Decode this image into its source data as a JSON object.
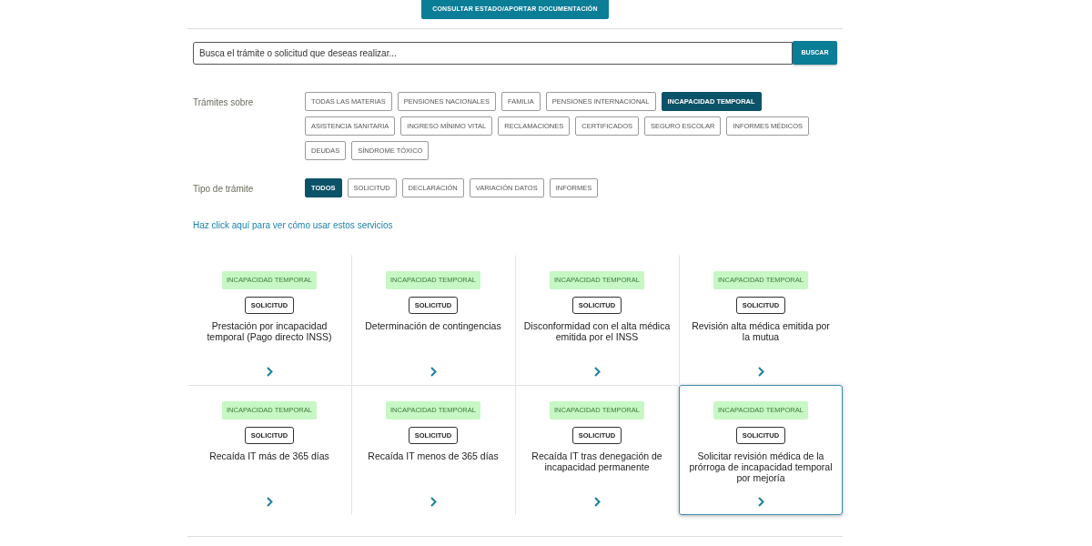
{
  "header": {
    "status_button": "CONSULTAR ESTADO/APORTAR DOCUMENTACIÓN"
  },
  "search": {
    "placeholder": "Busca el trámite o solicitud que deseas realizar...",
    "button": "BUSCAR"
  },
  "filters": [
    {
      "label": "Trámites sobre",
      "options": [
        {
          "label": "TODAS LAS MATERIAS",
          "selected": false
        },
        {
          "label": "PENSIONES NACIONALES",
          "selected": false
        },
        {
          "label": "FAMILIA",
          "selected": false
        },
        {
          "label": "PENSIONES INTERNACIONAL",
          "selected": false
        },
        {
          "label": "INCAPACIDAD TEMPORAL",
          "selected": true
        },
        {
          "label": "ASISTENCIA SANITARIA",
          "selected": false
        },
        {
          "label": "INGRESO MÍNIMO VITAL",
          "selected": false
        },
        {
          "label": "RECLAMACIONES",
          "selected": false
        },
        {
          "label": "CERTIFICADOS",
          "selected": false
        },
        {
          "label": "SEGURO ESCOLAR",
          "selected": false
        },
        {
          "label": "INFORMES MÉDICOS",
          "selected": false
        },
        {
          "label": "DEUDAS",
          "selected": false
        },
        {
          "label": "SÍNDROME TÓXICO",
          "selected": false
        }
      ]
    },
    {
      "label": "Tipo de trámite",
      "options": [
        {
          "label": "TODOS",
          "selected": true
        },
        {
          "label": "SOLICITUD",
          "selected": false
        },
        {
          "label": "DECLARACIÓN",
          "selected": false
        },
        {
          "label": "VARIACIÓN DATOS",
          "selected": false
        },
        {
          "label": "INFORMES",
          "selected": false
        }
      ]
    }
  ],
  "help_link": "Haz click aquí para ver cómo usar estos servicios",
  "cards": [
    {
      "category": "INCAPACIDAD TEMPORAL",
      "type": "SOLICITUD",
      "title": "Prestación por incapacidad temporal (Pago directo INSS)",
      "highlighted": false
    },
    {
      "category": "INCAPACIDAD TEMPORAL",
      "type": "SOLICITUD",
      "title": "Determinación de contingencias",
      "highlighted": false
    },
    {
      "category": "INCAPACIDAD TEMPORAL",
      "type": "SOLICITUD",
      "title": "Disconformidad con el alta médica emitida por el INSS",
      "highlighted": false
    },
    {
      "category": "INCAPACIDAD TEMPORAL",
      "type": "SOLICITUD",
      "title": "Revisión alta médica emitida por la mutua",
      "highlighted": false
    },
    {
      "category": "INCAPACIDAD TEMPORAL",
      "type": "SOLICITUD",
      "title": "Recaída IT más de 365 días",
      "highlighted": false
    },
    {
      "category": "INCAPACIDAD TEMPORAL",
      "type": "SOLICITUD",
      "title": "Recaída IT menos de 365 días",
      "highlighted": false
    },
    {
      "category": "INCAPACIDAD TEMPORAL",
      "type": "SOLICITUD",
      "title": "Recaída IT tras denegación de incapacidad permanente",
      "highlighted": false
    },
    {
      "category": "INCAPACIDAD TEMPORAL",
      "type": "SOLICITUD",
      "title": "Solicitar revisión médica de la prórroga de incapacidad temporal por mejoría",
      "highlighted": true
    }
  ]
}
